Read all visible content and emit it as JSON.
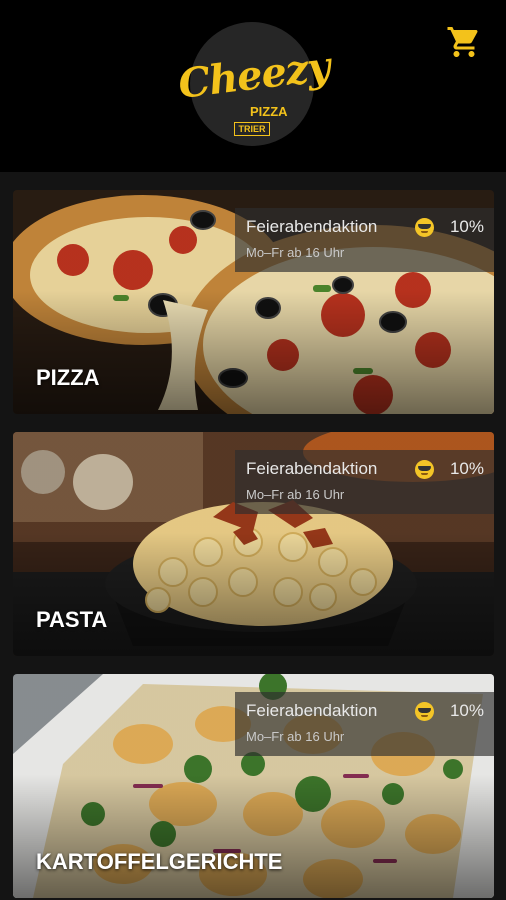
{
  "header": {
    "logo": {
      "main": "Cheezy",
      "sub": "PIZZA",
      "city": "TRIER"
    },
    "cart_icon": "shopping-cart-icon"
  },
  "colors": {
    "accent": "#f3c21b",
    "header_bg": "#000000",
    "page_bg": "#141414"
  },
  "categories": [
    {
      "title": "PIZZA",
      "promo": {
        "title": "Feierabendaktion",
        "emoji": "sunglasses-emoji",
        "percent": "10%",
        "subtitle": "Mo–Fr ab 16 Uhr"
      }
    },
    {
      "title": "PASTA",
      "promo": {
        "title": "Feierabendaktion",
        "emoji": "sunglasses-emoji",
        "percent": "10%",
        "subtitle": "Mo–Fr ab 16 Uhr"
      }
    },
    {
      "title": "KARTOFFELGERICHTE",
      "promo": {
        "title": "Feierabendaktion",
        "emoji": "sunglasses-emoji",
        "percent": "10%",
        "subtitle": "Mo–Fr ab 16 Uhr"
      }
    }
  ]
}
